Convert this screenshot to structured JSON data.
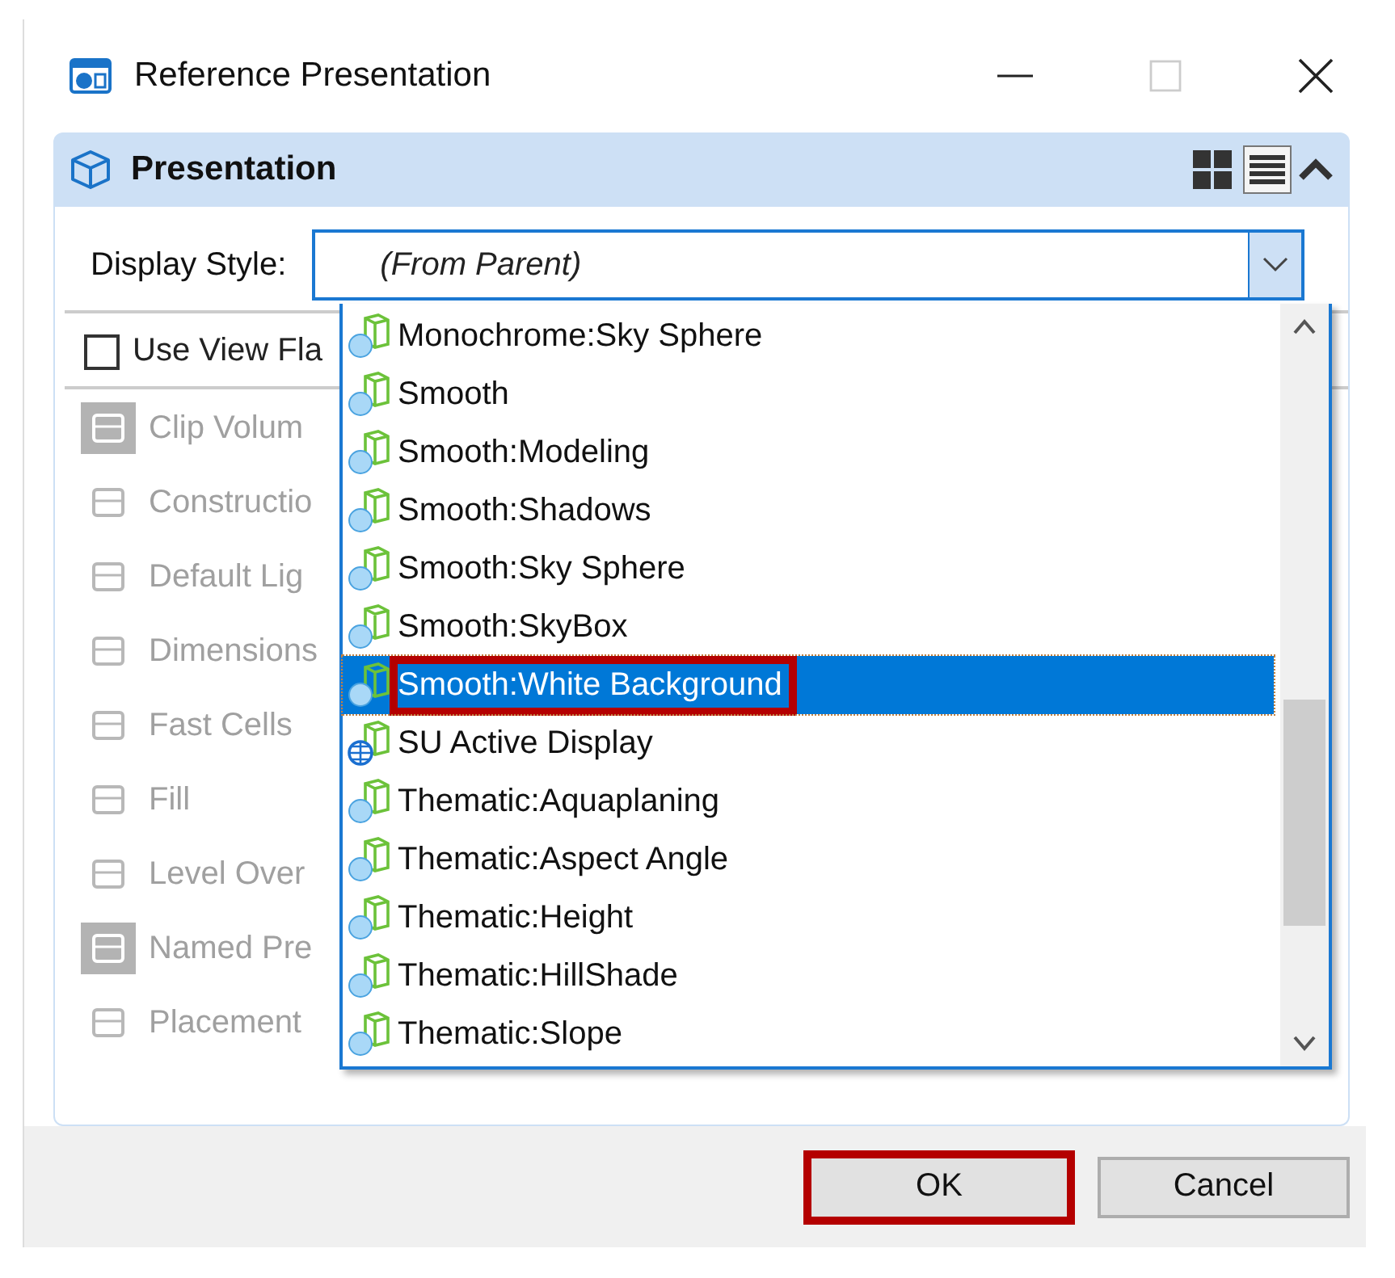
{
  "window": {
    "title": "Reference Presentation"
  },
  "panel": {
    "title": "Presentation",
    "view_modes": [
      {
        "kind": "grid",
        "selected": false
      },
      {
        "kind": "list",
        "selected": true
      }
    ],
    "expanded": true
  },
  "display_style": {
    "label": "Display Style:",
    "value": "(From Parent)",
    "open": true
  },
  "use_view_flags": {
    "label": "Use View Fla",
    "checked": false
  },
  "flags": [
    {
      "label": "Clip Volum",
      "on": true
    },
    {
      "label": "Constructio",
      "on": false
    },
    {
      "label": "Default Lig",
      "on": false
    },
    {
      "label": "Dimensions",
      "on": false
    },
    {
      "label": "Fast Cells",
      "on": false
    },
    {
      "label": "Fill",
      "on": false
    },
    {
      "label": "Level Over",
      "on": false
    },
    {
      "label": "Named Pre",
      "on": true
    },
    {
      "label": "Placement",
      "on": false
    }
  ],
  "dropdown_items": [
    {
      "label": "Monochrome:Sky Sphere",
      "kind": "style",
      "selected": false,
      "annotated": false
    },
    {
      "label": "Smooth",
      "kind": "style",
      "selected": false,
      "annotated": false
    },
    {
      "label": "Smooth:Modeling",
      "kind": "style",
      "selected": false,
      "annotated": false
    },
    {
      "label": "Smooth:Shadows",
      "kind": "style",
      "selected": false,
      "annotated": false
    },
    {
      "label": "Smooth:Sky Sphere",
      "kind": "style",
      "selected": false,
      "annotated": false
    },
    {
      "label": "Smooth:SkyBox",
      "kind": "style",
      "selected": false,
      "annotated": false
    },
    {
      "label": "Smooth:White Background",
      "kind": "style",
      "selected": true,
      "annotated": true
    },
    {
      "label": "SU Active Display",
      "kind": "global",
      "selected": false,
      "annotated": false
    },
    {
      "label": "Thematic:Aquaplaning",
      "kind": "style",
      "selected": false,
      "annotated": false
    },
    {
      "label": "Thematic:Aspect Angle",
      "kind": "style",
      "selected": false,
      "annotated": false
    },
    {
      "label": "Thematic:Height",
      "kind": "style",
      "selected": false,
      "annotated": false
    },
    {
      "label": "Thematic:HillShade",
      "kind": "style",
      "selected": false,
      "annotated": false
    },
    {
      "label": "Thematic:Slope",
      "kind": "style",
      "selected": false,
      "annotated": false
    }
  ],
  "buttons": [
    {
      "label": "OK",
      "annotated": true
    },
    {
      "label": "Cancel",
      "annotated": false
    }
  ]
}
